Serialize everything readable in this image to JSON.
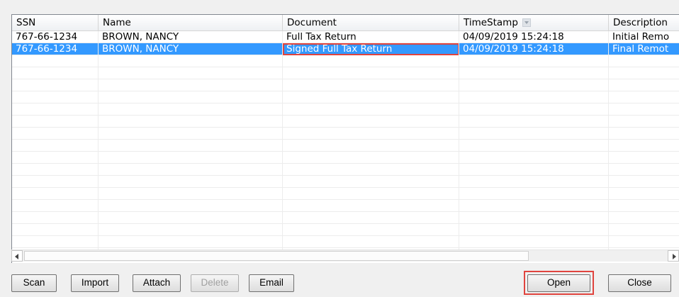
{
  "columns": [
    "SSN",
    "Name",
    "Document",
    "TimeStamp",
    "Description"
  ],
  "rows": [
    {
      "ssn": "767-66-1234",
      "name": "BROWN, NANCY",
      "document": "Full Tax Return",
      "timestamp": "04/09/2019 15:24:18",
      "description": "Initial Remo",
      "selected": false
    },
    {
      "ssn": "767-66-1234",
      "name": "BROWN, NANCY",
      "document": "Signed Full Tax Return",
      "timestamp": "04/09/2019 15:24:18",
      "description": "Final Remot",
      "selected": true
    }
  ],
  "buttons": {
    "scan": "Scan",
    "import": "Import",
    "attach": "Attach",
    "delete": "Delete",
    "email": "Email",
    "open": "Open",
    "close": "Close"
  },
  "colors": {
    "selection": "#3399ff",
    "highlight": "#e0443e"
  }
}
